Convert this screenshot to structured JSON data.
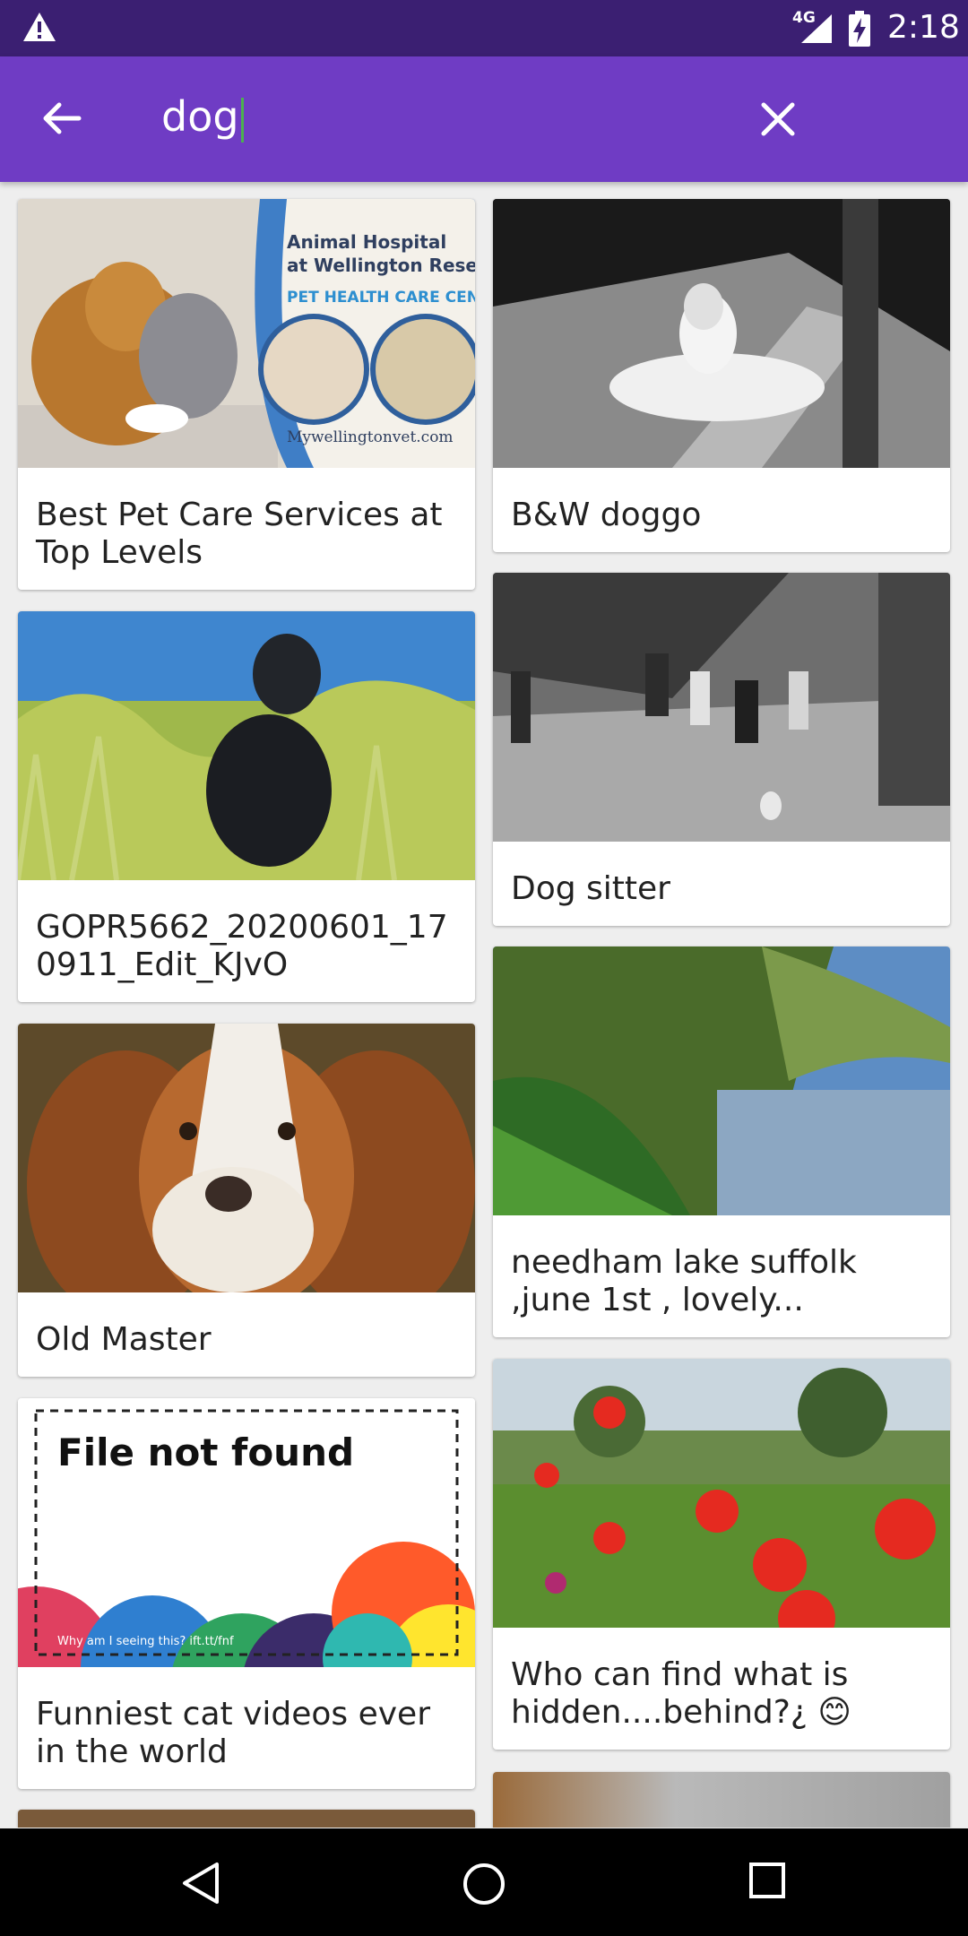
{
  "status_bar": {
    "network": "4G",
    "time": "2:18"
  },
  "search": {
    "query": "dog"
  },
  "results": [
    {
      "title": "Best Pet Care Services at Top Levels",
      "image_texts": [
        "Animal Hospital",
        "at Wellington Reserve",
        "PET HEALTH CARE CENTER",
        "Mywellingtonvet.com"
      ]
    },
    {
      "title": "B&W doggo"
    },
    {
      "title": "GOPR5662_20200601_170911_Edit_KJvO"
    },
    {
      "title": "Dog sitter"
    },
    {
      "title": "Old Master"
    },
    {
      "title": "needham lake suffolk ,june 1st , lovely..."
    },
    {
      "title": "Funniest cat videos ever in the world",
      "image_texts": [
        "File not found",
        "Why am I seeing this? ift.tt/fnf"
      ]
    },
    {
      "title": "Who can find what is hidden....behind?¿ 😊"
    }
  ],
  "colors": {
    "status_bar": "#3b1f72",
    "app_bar": "#6f3cc4",
    "cursor": "#4caf50",
    "background": "#eeeeee"
  }
}
